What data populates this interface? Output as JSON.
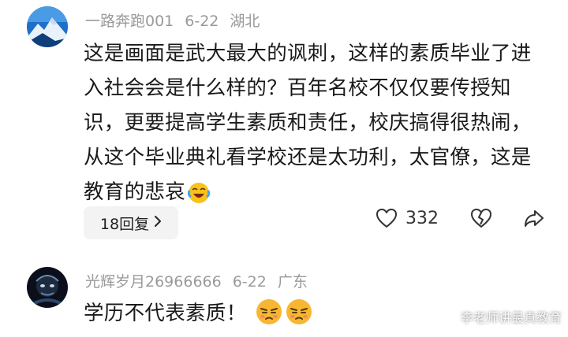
{
  "comments": [
    {
      "username": "一路奔跑001",
      "date": "6-22",
      "location": "湖北",
      "text": "这是画面是武大最大的讽刺，这样的素质毕业了进入社会会是什么样的？百年名校不仅仅要传授知识，更要提高学生素质和责任，校庆搞得很热闹，从这个毕业典礼看学校还是太功利，太官僚，这是教育的悲哀",
      "text_emoji": "laughing-crying-emoji",
      "replies_label": "18回复",
      "like_count": "332",
      "avatar": "snow-mountain-avatar"
    },
    {
      "username": "光辉岁月26966666",
      "date": "6-22",
      "location": "广东",
      "text": "学历不代表素质！",
      "text_emojis": [
        "annoyed-face-emoji",
        "annoyed-face-emoji"
      ],
      "avatar": "dark-portrait-avatar"
    }
  ],
  "watermark": "李老师讲最真教育",
  "icons": {
    "like": "heart-icon",
    "dislike": "broken-heart-icon",
    "share": "share-arrow-icon",
    "chevron": "chevron-right-icon"
  },
  "colors": {
    "meta_text": "#9a9a9a",
    "body_text": "#1a1a1a",
    "reply_pill": "#f3f3f3"
  }
}
